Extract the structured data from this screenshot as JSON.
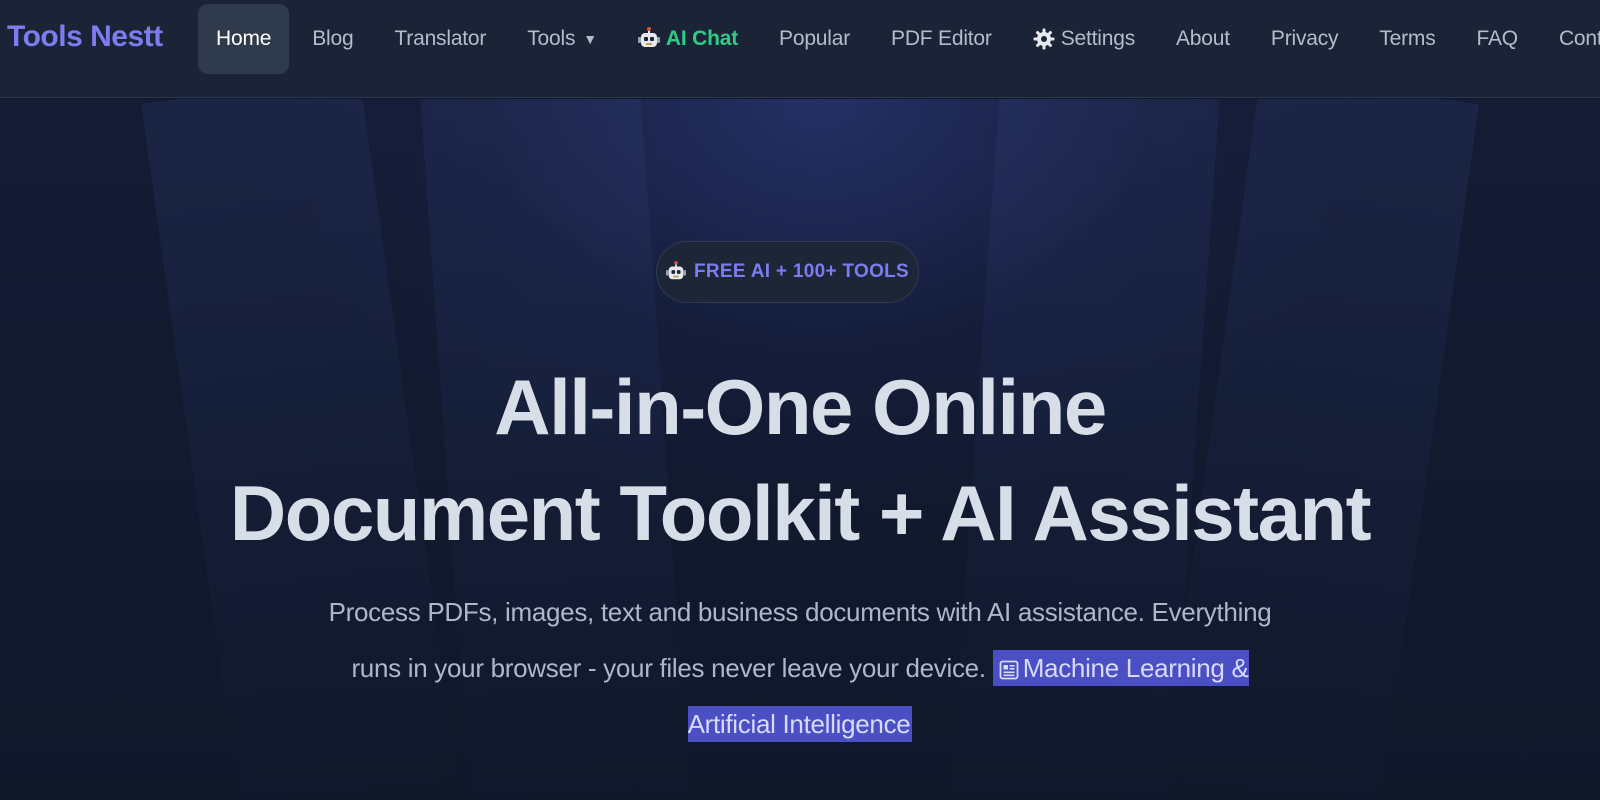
{
  "brand": {
    "name": "Tools Nestt",
    "color": "#7c7cf0"
  },
  "nav": {
    "items": [
      {
        "label": "Home",
        "active": true
      },
      {
        "label": "Blog"
      },
      {
        "label": "Translator"
      },
      {
        "label": "Tools",
        "dropdown_caret": "▼"
      },
      {
        "label": "AI Chat",
        "icon": "robot-icon",
        "accent": "#2ecc84"
      },
      {
        "label": "Popular"
      },
      {
        "label": "PDF Editor"
      },
      {
        "label": "Settings",
        "icon": "gear-icon"
      },
      {
        "label": "About"
      },
      {
        "label": "Privacy"
      },
      {
        "label": "Terms"
      },
      {
        "label": "FAQ"
      },
      {
        "label": "Contact"
      }
    ]
  },
  "hero": {
    "badge": {
      "label": "FREE AI + 100+ TOOLS",
      "icon": "robot-icon",
      "color": "#7b7cf2"
    },
    "headline_line1": "All-in-One Online",
    "headline_line2": "Document Toolkit + AI Assistant",
    "subtitle_text": "Process PDFs, images, text and business documents with AI assistance. Everything runs in your browser - your files never leave your device.",
    "highlight": {
      "icon": "article-icon",
      "text": "Machine Learning & Artificial Intelligence",
      "color": "#4a4fc4"
    }
  }
}
